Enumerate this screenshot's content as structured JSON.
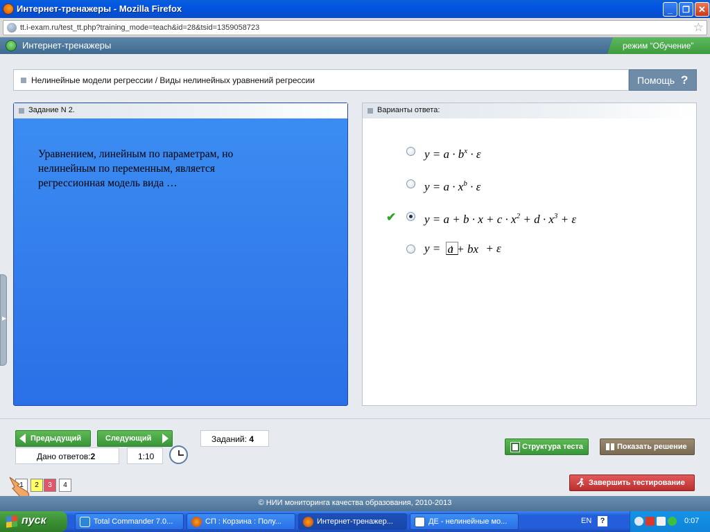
{
  "window": {
    "title": "Интернет-тренажеры - Mozilla Firefox",
    "min_glyph": "_",
    "max_glyph": "❐",
    "close_glyph": "✕"
  },
  "browser": {
    "url": "tt.i-exam.ru/test_tt.php?training_mode=teach&id=28&tsid=1359058723",
    "bookmark_glyph": "☆"
  },
  "app": {
    "name": "Интернет-тренажеры",
    "mode": "режим “Обучение”"
  },
  "breadcrumb": "Нелинейные модели регрессии / Виды нелинейных уравнений регрессии",
  "help": {
    "label": "Помощь",
    "glyph": "?"
  },
  "task_panel": {
    "title": "Задание N 2.",
    "question": "Уравнением, линейным по параметрам, но нелинейным по переменным,  является регрессионная модель вида …"
  },
  "answers_panel": {
    "title": "Варианты ответа:",
    "selected_index": 2,
    "correct_mark": "✔",
    "options": [
      {
        "main": "y = a · b",
        "sup": "x",
        "tail": " · ε"
      },
      {
        "main": "y = a · x",
        "sup": "b",
        "tail": " · ε"
      },
      {
        "parts": [
          "y = a + b · x + c · x",
          "2",
          " + d · x",
          "3",
          " + ε"
        ]
      },
      {
        "lhs": "y = ",
        "num": "1",
        "den": "a + bx",
        "tail": " + ε"
      }
    ]
  },
  "nav": {
    "prev": "Предыдущий",
    "next": "Следующий",
    "tasks_label": "Заданий:",
    "tasks_count": "4",
    "answered_label": "Дано ответов:",
    "answered_count": "2",
    "timer": "1:10",
    "pages": [
      "1",
      "2",
      "3",
      "4"
    ],
    "structure": "Структура теста",
    "show_solution": "Показать решение",
    "finish": "Завершить тестирование"
  },
  "footer": "© НИИ мониторинга качества образования, 2010-2013",
  "taskbar": {
    "start": "пуск",
    "tasks": [
      "Total Commander 7.0...",
      "СП : Корзина : Полу...",
      "Интернет-тренажер...",
      "ДЕ - нелинейные мо..."
    ],
    "lang": "EN",
    "help": "?",
    "clock": "0:07"
  },
  "colors": {
    "accent_green": "#3e9b3e",
    "header_blue": "#4d7396",
    "finish_red": "#bb2e2e",
    "solution_brown": "#7a6a52"
  }
}
